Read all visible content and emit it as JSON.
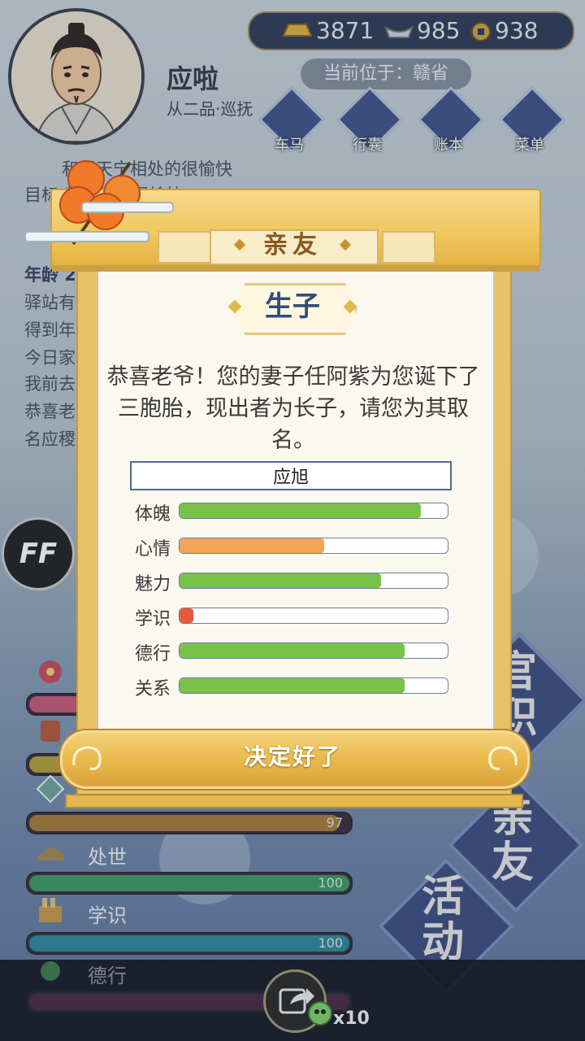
{
  "header": {
    "player_name": "应啦",
    "player_rank": "从二品·巡抚",
    "currency": {
      "gold": "3871",
      "silver": "985",
      "coin": "938"
    },
    "location": "当前位于：赣省"
  },
  "top_menu": [
    {
      "label": "车马"
    },
    {
      "label": "行囊"
    },
    {
      "label": "账本"
    },
    {
      "label": "菜单"
    }
  ],
  "log": {
    "lines": [
      "和罗天宁相处的很愉快",
      "目标      紫相处的很愉快",
      "年龄 2",
      "驿站有",
      "得到年",
      "今日家                                                人唤",
      "我前去",
      "恭喜老                                                子取",
      "名应稷"
    ]
  },
  "ff_button": "FF",
  "stats": [
    {
      "label": "",
      "value": "",
      "fill": 1.0,
      "color": "#c45a78"
    },
    {
      "label": "",
      "value": "",
      "fill": 1.0,
      "color": "#b4a03a"
    },
    {
      "label": "",
      "value": "97",
      "fill": 0.97,
      "color": "#a77c3b"
    },
    {
      "label": "处世",
      "value": "100",
      "fill": 1.0,
      "color": "#3e9a64"
    },
    {
      "label": "学识",
      "value": "100",
      "fill": 1.0,
      "color": "#2e8a9a"
    },
    {
      "label": "德行",
      "value": "",
      "fill": 1.0,
      "color": "#7a3a5a"
    }
  ],
  "side_buttons": [
    {
      "label": "官职",
      "line1": "官",
      "line2": "职"
    },
    {
      "label": "亲友",
      "line1": "亲",
      "line2": "友"
    },
    {
      "label": "活动",
      "line1": "活",
      "line2": "动"
    }
  ],
  "bottom": {
    "ticket_count": "x10"
  },
  "dialog": {
    "title": "亲友",
    "event": "生子",
    "text": "恭喜老爷！您的妻子任阿紫为您诞下了三胞胎，现出者为长子，请您为其取名。",
    "child_name": "应旭",
    "attributes": [
      {
        "label": "体魄",
        "fill": 0.9,
        "color": "#78c24a"
      },
      {
        "label": "心情",
        "fill": 0.54,
        "color": "#f0a55a"
      },
      {
        "label": "魅力",
        "fill": 0.75,
        "color": "#78c24a"
      },
      {
        "label": "学识",
        "fill": 0.05,
        "color": "#e85a3c"
      },
      {
        "label": "德行",
        "fill": 0.84,
        "color": "#78c24a"
      },
      {
        "label": "关系",
        "fill": 0.84,
        "color": "#78c24a"
      }
    ],
    "confirm": "决定好了"
  }
}
